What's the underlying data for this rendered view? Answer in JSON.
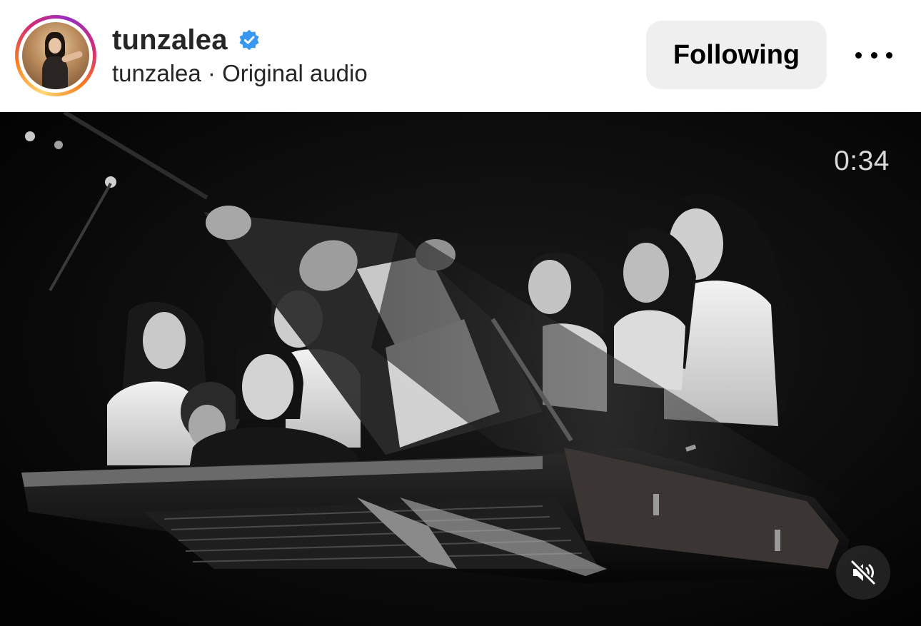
{
  "header": {
    "username": "tunzalea",
    "verified": true,
    "audio_line": "tunzalea · Original audio",
    "follow_label": "Following",
    "more_icon": "more-horizontal-icon"
  },
  "video": {
    "timestamp": "0:34",
    "muted": true,
    "mute_icon": "speaker-muted-icon"
  },
  "colors": {
    "verified_blue": "#3897f0",
    "button_bg": "#efefef",
    "text": "#262626"
  }
}
